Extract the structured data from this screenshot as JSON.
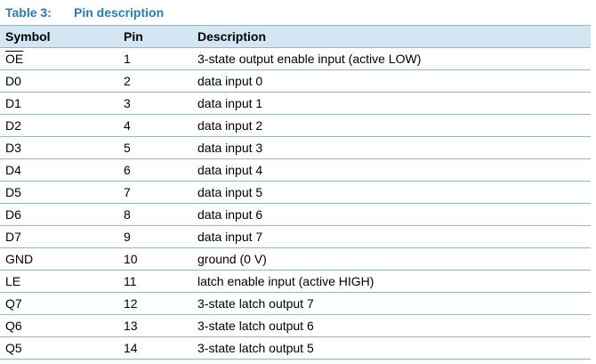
{
  "caption": {
    "label": "Table 3:",
    "title": "Pin description"
  },
  "colors": {
    "caption_text": "#2a7ab0",
    "header_background": "#d3e6f2",
    "rule": "#8fb7d2"
  },
  "table": {
    "headers": {
      "symbol": "Symbol",
      "pin": "Pin",
      "description": "Description"
    },
    "rows": [
      {
        "symbol": "OE",
        "symbol_overbar": true,
        "pin": "1",
        "description": "3-state output enable input (active LOW)"
      },
      {
        "symbol": "D0",
        "pin": "2",
        "description": "data input 0"
      },
      {
        "symbol": "D1",
        "pin": "3",
        "description": "data input 1"
      },
      {
        "symbol": "D2",
        "pin": "4",
        "description": "data input 2"
      },
      {
        "symbol": "D3",
        "pin": "5",
        "description": "data input 3"
      },
      {
        "symbol": "D4",
        "pin": "6",
        "description": "data input 4"
      },
      {
        "symbol": "D5",
        "pin": "7",
        "description": "data input 5"
      },
      {
        "symbol": "D6",
        "pin": "8",
        "description": "data input 6"
      },
      {
        "symbol": "D7",
        "pin": "9",
        "description": "data input 7"
      },
      {
        "symbol": "GND",
        "pin": "10",
        "description": "ground (0 V)"
      },
      {
        "symbol": "LE",
        "pin": "11",
        "description": "latch enable input (active HIGH)"
      },
      {
        "symbol": "Q7",
        "pin": "12",
        "description": "3-state latch output 7"
      },
      {
        "symbol": "Q6",
        "pin": "13",
        "description": "3-state latch output 6"
      },
      {
        "symbol": "Q5",
        "pin": "14",
        "description": "3-state latch output 5"
      }
    ]
  }
}
